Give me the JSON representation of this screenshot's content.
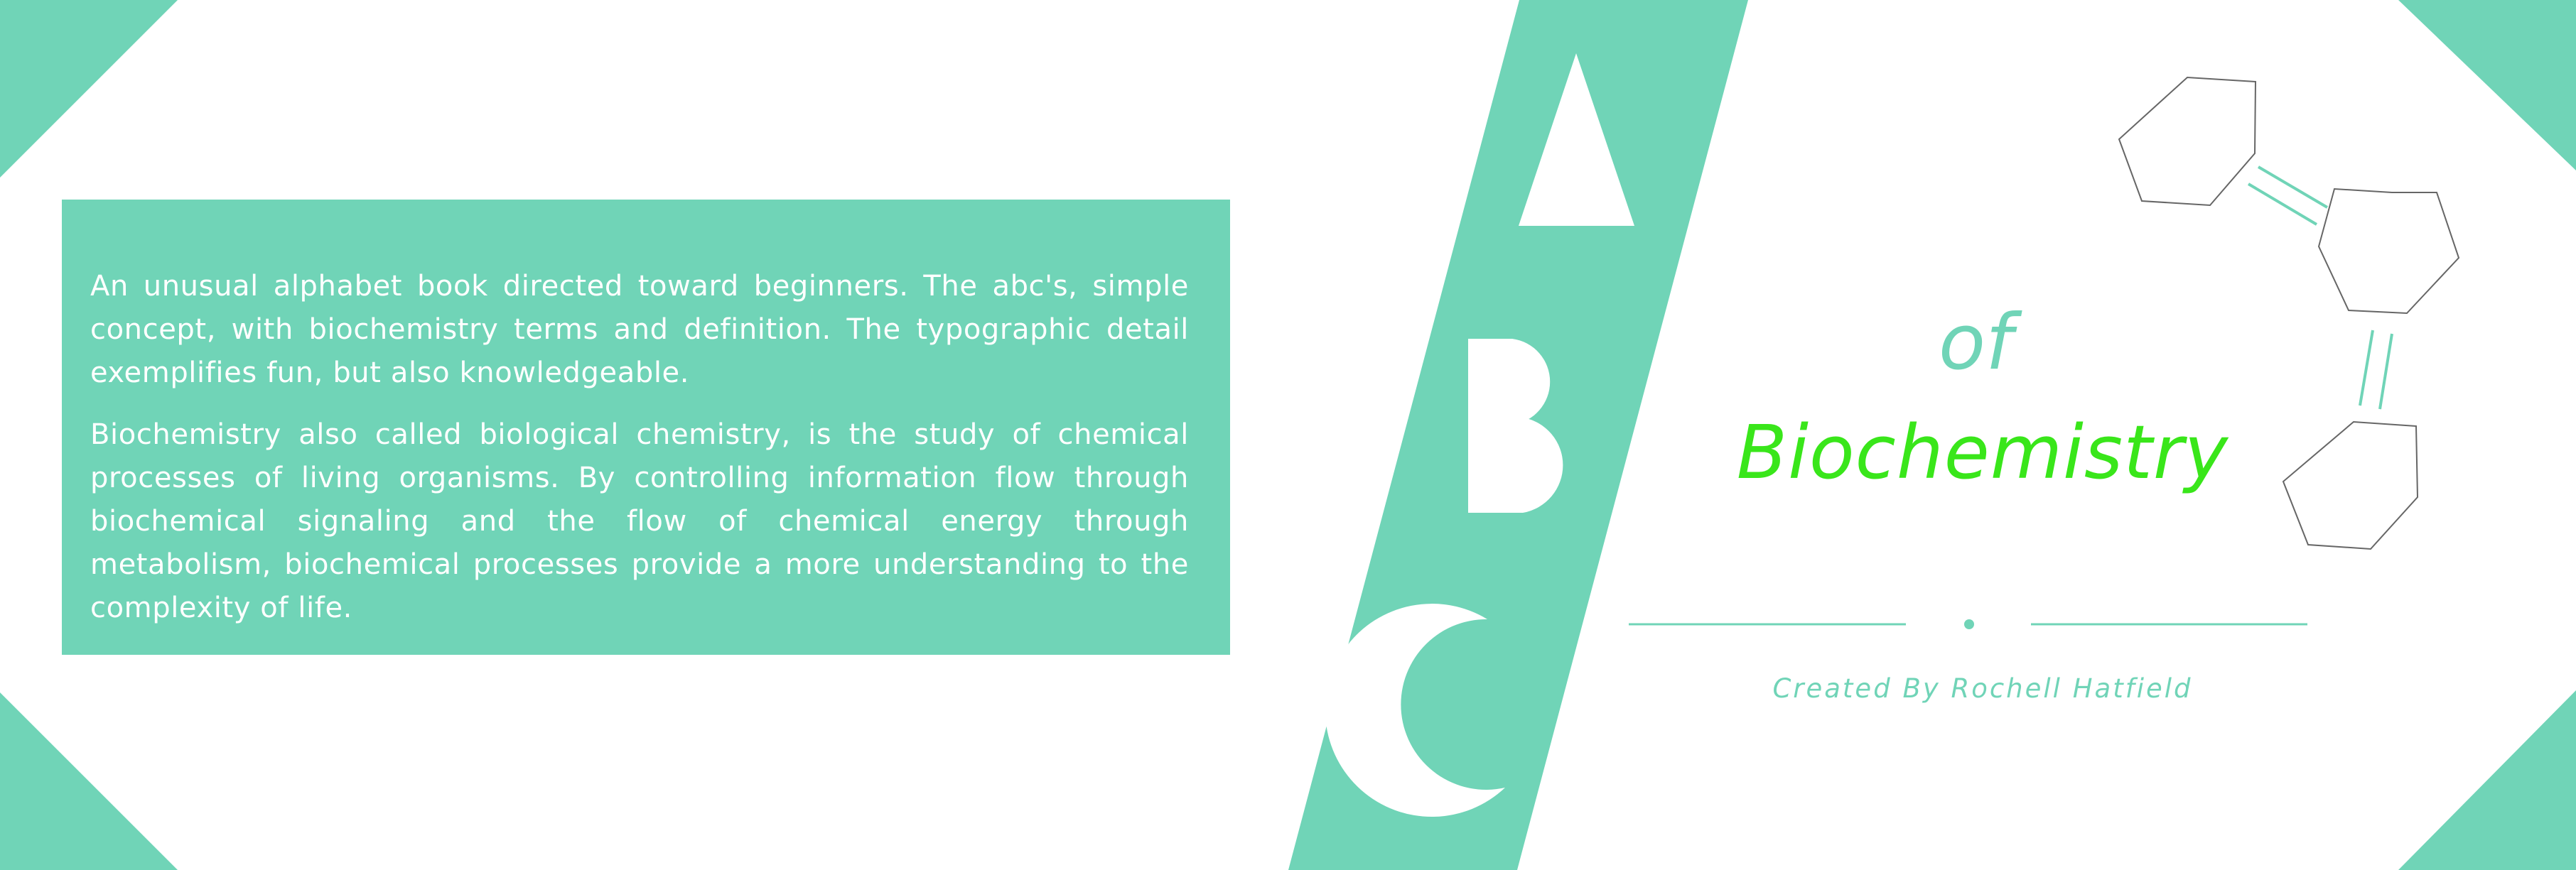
{
  "description": {
    "paragraph_1": "An unusual alphabet book directed toward beginners. The abc's, simple concept, with biochemistry terms and definition. The typographic detail exemplifies fun, but also knowledgeable.",
    "paragraph_2": "Biochemistry also called biological chemistry, is the study of chemical processes of living organisms. By controlling information flow through biochemical signaling and the flow of chemical energy through metabolism, biochemical processes provide a more understanding to the complexity of life."
  },
  "cover": {
    "letters": [
      "A",
      "B",
      "C"
    ],
    "title_small": "of",
    "title_main": "Biochemistry",
    "credit": "Created By Rochell Hatfield",
    "icon": "molecule-hexagons-icon"
  },
  "colors": {
    "accent": "#70d4b7",
    "title": "#39e61a",
    "background": "#ffffff",
    "line_art": "#666666"
  }
}
